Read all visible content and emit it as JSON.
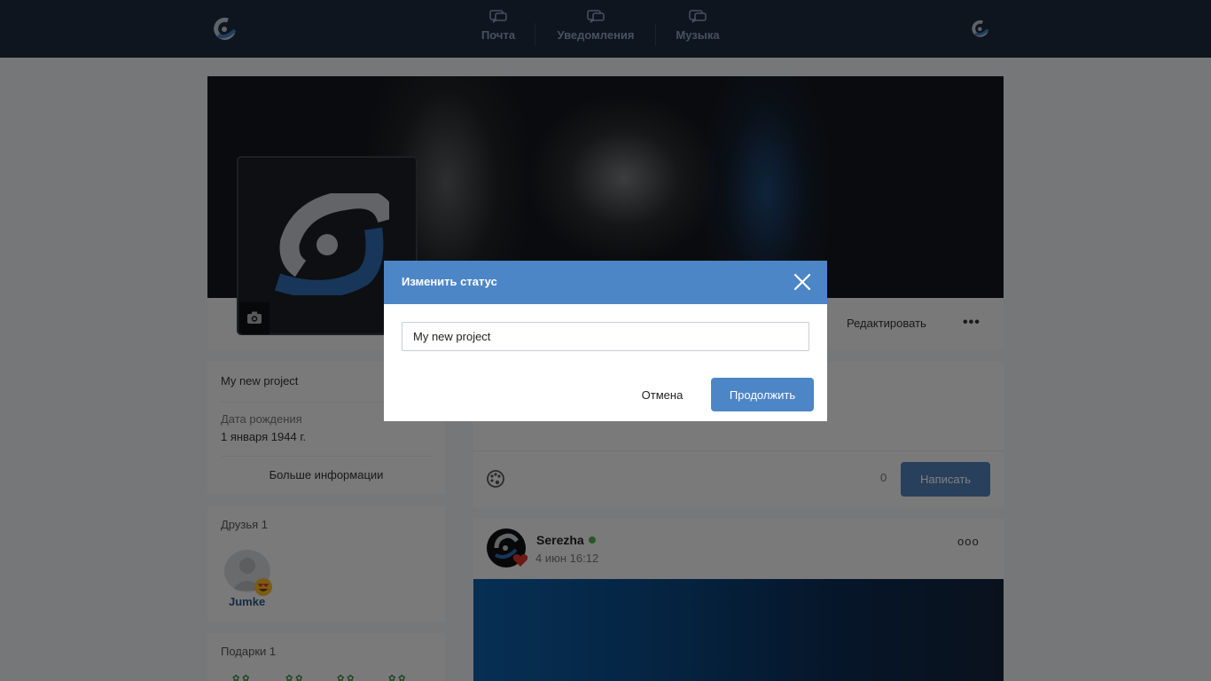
{
  "nav": {
    "items": [
      {
        "label": "Почта",
        "icon": "chat-icon"
      },
      {
        "label": "Уведомления",
        "icon": "chat-icon"
      },
      {
        "label": "Музыка",
        "icon": "chat-icon"
      }
    ]
  },
  "profile": {
    "edit_label": "Редактировать",
    "more_label": "•••",
    "status": "My new project",
    "dob_label": "Дата рождения",
    "dob_value": "1 января 1944 г.",
    "more_info_label": "Больше информации"
  },
  "friends": {
    "title": "Друзья 1",
    "items": [
      {
        "name": "Jumke"
      }
    ]
  },
  "gifts": {
    "title": "Подарки 1"
  },
  "composer": {
    "counter": "0",
    "write_label": "Написать"
  },
  "post": {
    "author": "Serezha",
    "date": "4 июн 16:12",
    "menu_label": "ооо"
  },
  "modal": {
    "title": "Изменить статус",
    "input_value": "My new project",
    "cancel_label": "Отмена",
    "continue_label": "Продолжить"
  },
  "colors": {
    "topbar": "#1d2a3d",
    "accent": "#4d86c7",
    "online": "#4bb34b"
  }
}
